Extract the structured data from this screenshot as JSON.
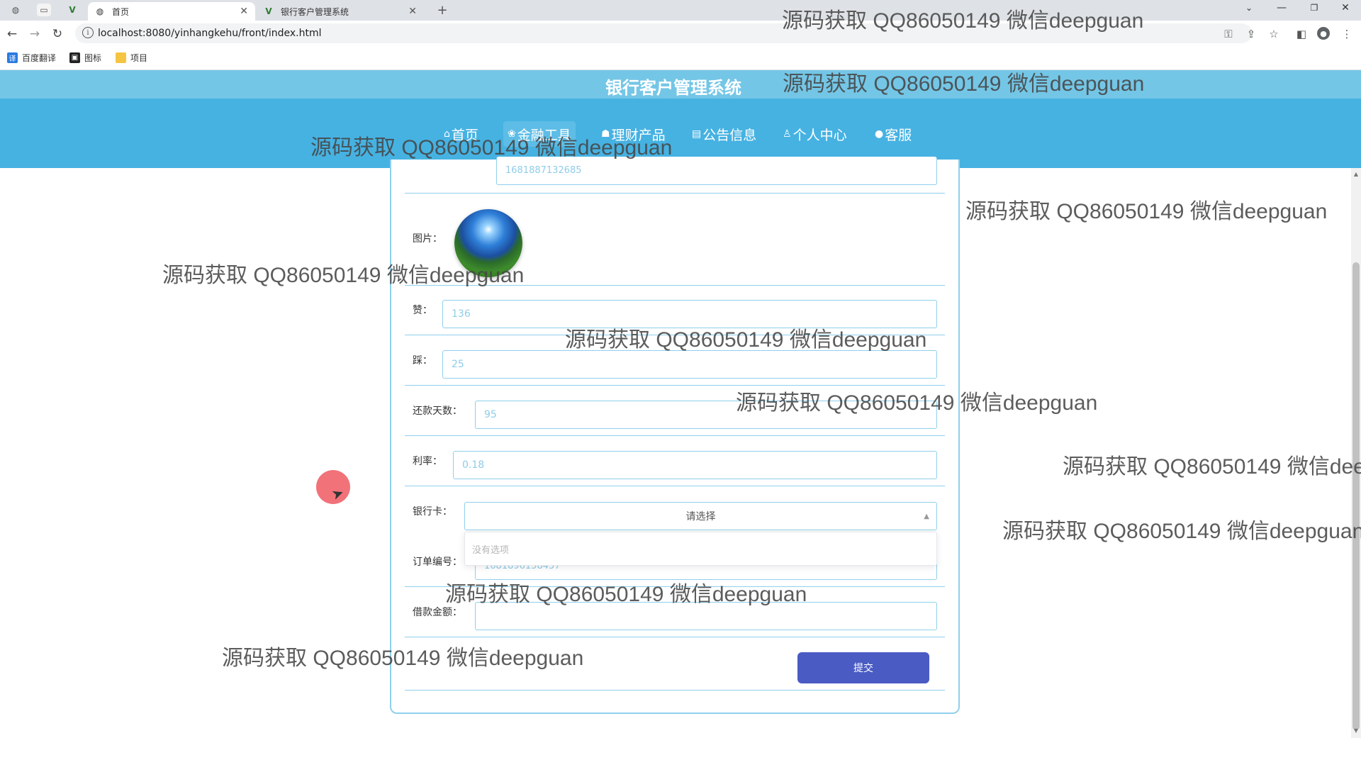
{
  "browser": {
    "tabs": [
      {
        "label": "首页",
        "active": true
      },
      {
        "label": "银行客户管理系统",
        "active": false
      }
    ],
    "new_tab_symbol": "+",
    "url": "localhost:8080/yinhangkehu/front/index.html",
    "bookmarks": [
      "百度翻译",
      "图标",
      "项目"
    ]
  },
  "site": {
    "title": "银行客户管理系统",
    "nav": [
      {
        "label": "首页",
        "icon": "home-icon",
        "glyph": "⌂",
        "active": false
      },
      {
        "label": "金融工具",
        "icon": "gear-icon",
        "glyph": "❀",
        "active": true
      },
      {
        "label": "理财产品",
        "icon": "cap-icon",
        "glyph": "☗",
        "active": false
      },
      {
        "label": "公告信息",
        "icon": "notice-icon",
        "glyph": "▤",
        "active": false
      },
      {
        "label": "个人中心",
        "icon": "user-icon",
        "glyph": "♙",
        "active": false
      },
      {
        "label": "客服",
        "icon": "service-icon",
        "glyph": "●",
        "active": false
      }
    ]
  },
  "form": {
    "top_value": "1681887132685",
    "image_label": "图片：",
    "fields": [
      {
        "key": "zan",
        "label": "赞：",
        "value": "136"
      },
      {
        "key": "cai",
        "label": "踩：",
        "value": "25"
      },
      {
        "key": "days",
        "label": "还款天数：",
        "value": "95"
      },
      {
        "key": "rate",
        "label": "利率：",
        "value": "0.18"
      }
    ],
    "bank_card": {
      "label": "银行卡：",
      "placeholder": "请选择",
      "no_options": "没有选项"
    },
    "order_no": {
      "label": "订单编号：",
      "value": "1681896158457"
    },
    "loan_amount": {
      "label": "借款金额：",
      "value": ""
    },
    "submit_label": "提交"
  },
  "watermark": "源码获取 QQ86050149 微信deepguan",
  "colors": {
    "header_strip": "#74c6e6",
    "navbar": "#46b2e2",
    "field_border": "#8fd0ec",
    "submit": "#4a5bc4"
  }
}
